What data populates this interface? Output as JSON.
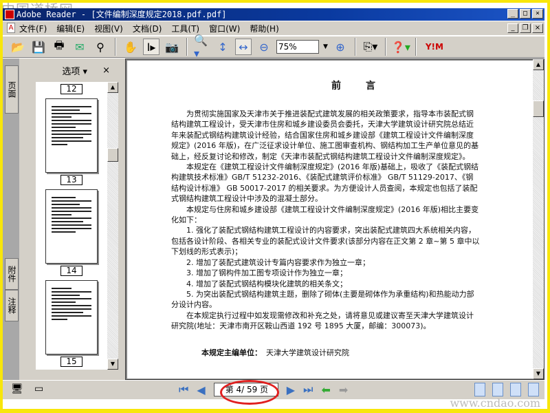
{
  "watermark_top": "中国道桥网",
  "watermark_bottom": "www.cndao.com",
  "titlebar": {
    "title": "Adobe Reader - [文件编制深度规定2018.pdf.pdf]"
  },
  "menu": [
    "文件(F)",
    "编辑(E)",
    "视图(V)",
    "文档(D)",
    "工具(T)",
    "窗口(W)",
    "帮助(H)"
  ],
  "toolbar": {
    "zoom": "75%"
  },
  "sidebar": {
    "tabs": [
      "页面",
      "附件",
      "注释"
    ],
    "options": "选项 ▾",
    "close": "×",
    "pages": [
      "12",
      "13",
      "14",
      "15"
    ]
  },
  "document": {
    "heading": "前言",
    "paragraphs": [
      "为贯彻实施国家及天津市关于推进装配式建筑发展的相关政策要求，指导本市装配式钢结构建筑工程设计，受天津市住房和城乡建设委员会委托，天津大学建筑设计研究院总结近年来装配式钢结构建筑设计经验，结合国家住房和城乡建设部《建筑工程设计文件编制深度规定》(2016 年版)，在广泛征求设计单位、施工图审查机构、钢结构加工生产单位意见的基础上，经反复讨论和修改，制定《天津市装配式钢结构建筑工程设计文件编制深度规定》。",
      "本规定在《建筑工程设计文件编制深度规定》(2016 年版)基础上，吸收了《装配式钢结构建筑技术标准》GB/T 51232-2016、《装配式建筑评价标准》 GB/T 51129-2017、《钢结构设计标准》 GB 50017-2017 的相关要求。为方便设计人员查阅，本规定也包括了装配式钢结构建筑工程设计中涉及的混凝土部分。",
      "本规定与住房和城乡建设部《建筑工程设计文件编制深度规定》(2016 年版)相比主要变化如下：",
      "1. 强化了装配式钢结构建筑工程设计的内容要求，突出装配式建筑四大系统相关内容，包括各设计阶段、各相关专业的装配式设计文件要求(该部分内容在正文第 2 章~第 5 章中以下划线的形式表示)；",
      "2. 增加了装配式建筑设计专篇内容要求作为独立一章；",
      "3. 增加了钢构件加工图专项设计作为独立一章；",
      "4. 增加了装配式钢结构模块化建筑的相关条文；",
      "5. 为突出装配式钢结构建筑主题，删除了砌体(主要是砌体作为承重结构)和热能动力部分设计内容。",
      "在本规定执行过程中如发现需修改和补充之处，请将意见或建议寄至天津大学建筑设计研究院(地址：天津市南开区鞍山西道 192 号 1895 大厦，邮编：300073)。"
    ],
    "editor_label": "本规定主编单位：",
    "editor_value": "天津大学建筑设计研究院"
  },
  "statusbar": {
    "page": "第 4/ 59 页"
  }
}
